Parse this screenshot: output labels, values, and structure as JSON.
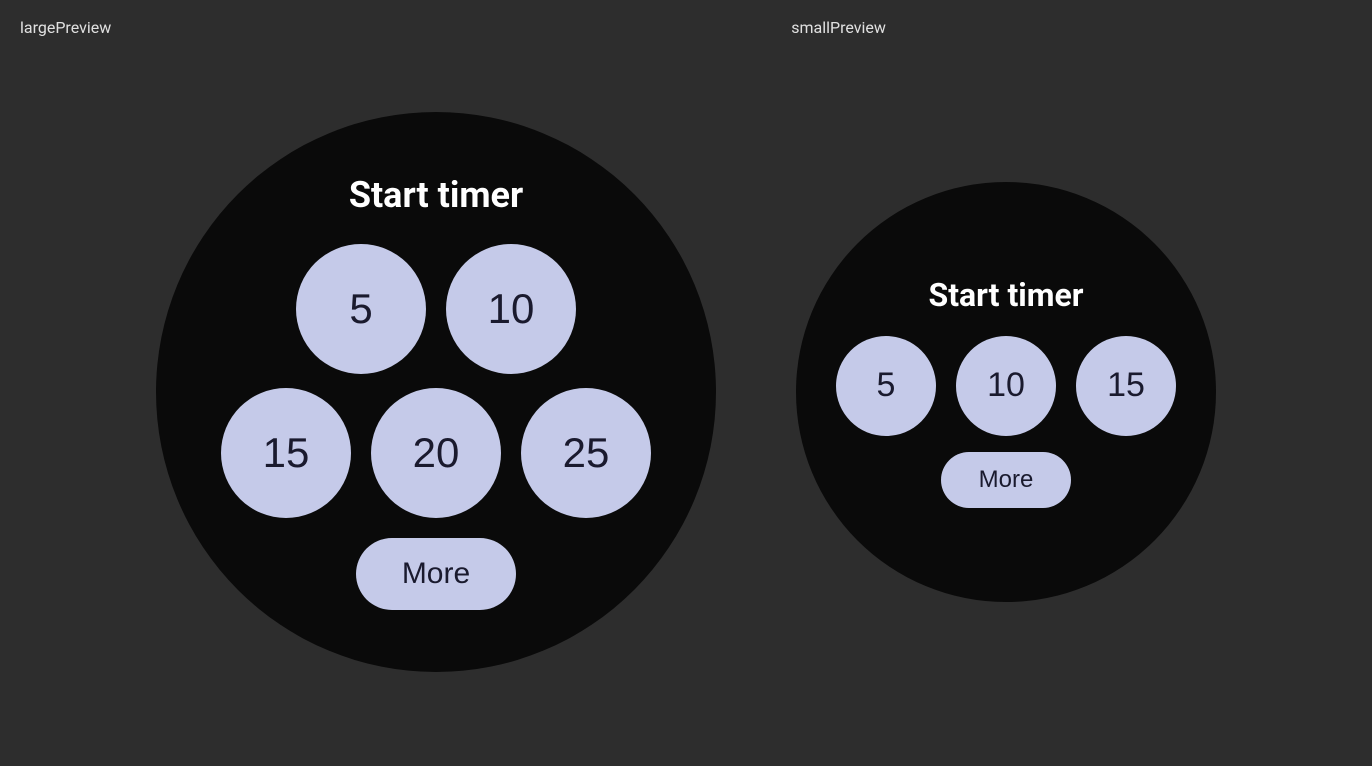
{
  "labels": {
    "large": "largePreview",
    "small": "smallPreview"
  },
  "large_preview": {
    "title": "Start timer",
    "row1": [
      "5",
      "10"
    ],
    "row2": [
      "15",
      "20",
      "25"
    ],
    "more": "More"
  },
  "small_preview": {
    "title": "Start timer",
    "row1": [
      "5",
      "10",
      "15"
    ],
    "more": "More"
  },
  "colors": {
    "background": "#2d2d2d",
    "watch_bg": "#0a0a0a",
    "button_bg": "#c5cae9",
    "button_text": "#1a1a2e",
    "title_text": "#ffffff",
    "label_text": "#e0e0e0"
  }
}
